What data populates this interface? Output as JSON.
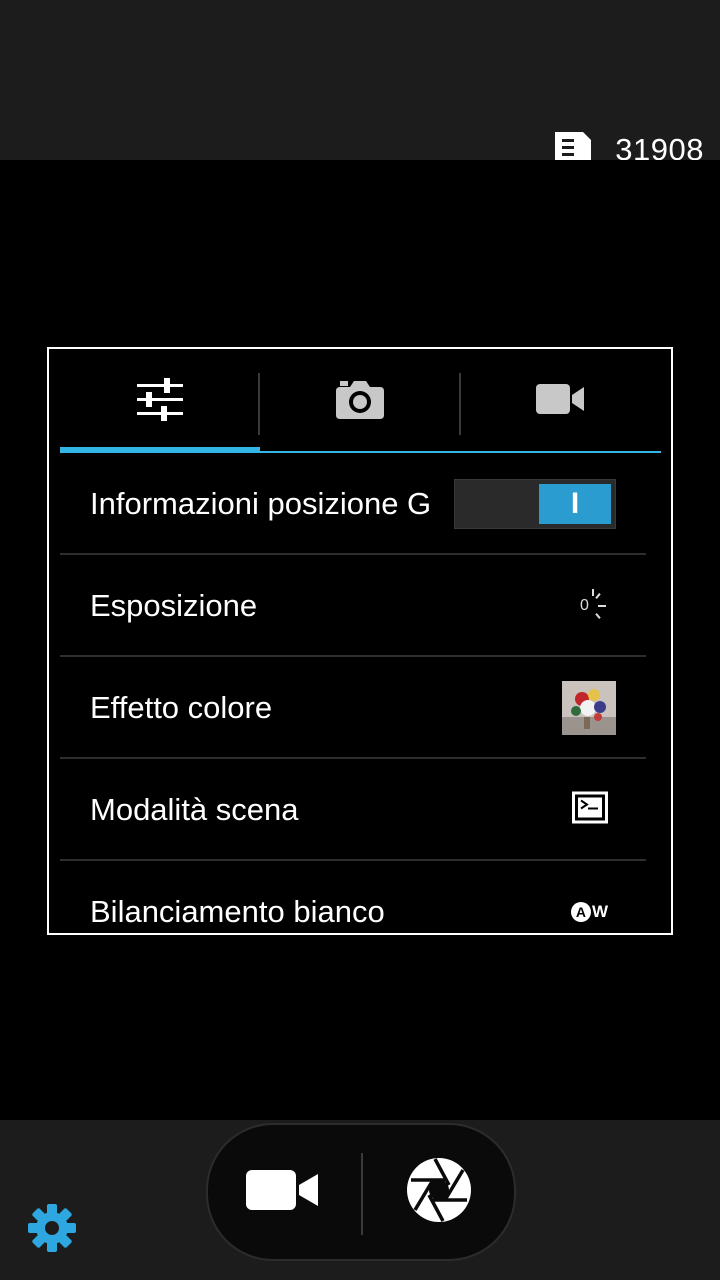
{
  "status": {
    "storage_icon": "sd-card-icon",
    "remaining_photos": "31908"
  },
  "settings_panel": {
    "tabs": [
      {
        "icon": "sliders-icon",
        "active": true
      },
      {
        "icon": "camera-icon",
        "active": false
      },
      {
        "icon": "video-camera-icon",
        "active": false
      }
    ],
    "rows": [
      {
        "label": "Informazioni posizione G",
        "control": "toggle",
        "value": "I"
      },
      {
        "label": "Esposizione",
        "control": "icon",
        "icon": "exposure-icon",
        "value": "0"
      },
      {
        "label": "Effetto colore",
        "control": "thumbnail",
        "icon": "color-effect-thumbnail"
      },
      {
        "label": "Modalità scena",
        "control": "icon",
        "icon": "scene-mode-icon"
      },
      {
        "label": "Bilanciamento bianco",
        "control": "icon",
        "icon": "white-balance-auto-icon",
        "value": "AW"
      }
    ]
  },
  "controls": {
    "video_mode_icon": "video-camera-icon",
    "shutter_icon": "shutter-icon",
    "settings_icon": "gear-icon"
  },
  "colors": {
    "accent": "#33b5e5",
    "toggle_on": "#2b9ccf",
    "settings_gear": "#2ea7e0"
  }
}
